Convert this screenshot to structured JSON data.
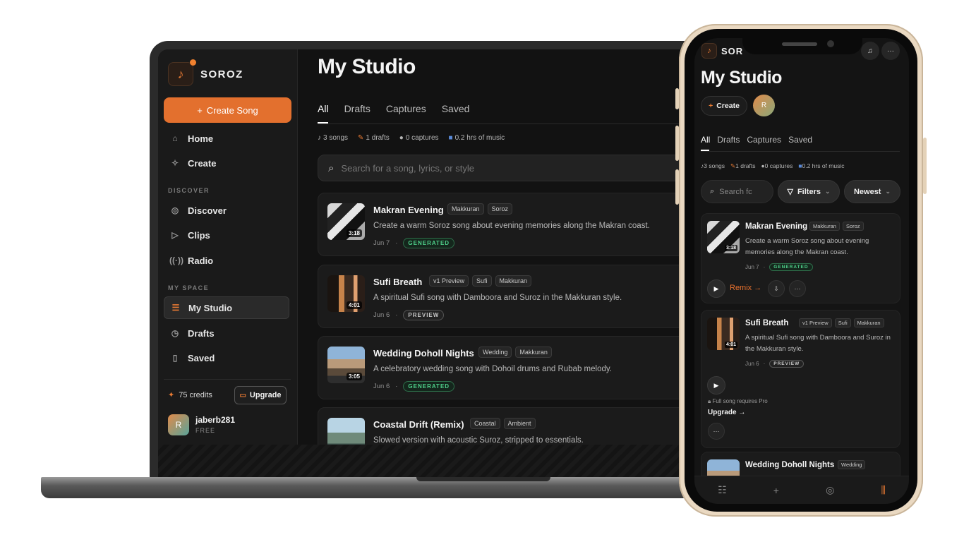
{
  "brand": {
    "name": "SOROZ",
    "short": "SOR"
  },
  "sidebar": {
    "create_label": "Create Song",
    "nav_home": "Home",
    "nav_create": "Create",
    "section_discover": "DISCOVER",
    "nav_discover": "Discover",
    "nav_clips": "Clips",
    "nav_radio": "Radio",
    "section_myspace": "MY SPACE",
    "nav_mystudio": "My Studio",
    "nav_drafts": "Drafts",
    "nav_saved": "Saved",
    "credits": "75 credits",
    "upgrade": "Upgrade",
    "user_name": "jaberb281",
    "user_plan": "FREE",
    "user_initial": "R"
  },
  "main": {
    "title": "My Studio",
    "tabs": [
      "All",
      "Drafts",
      "Captures",
      "Saved"
    ],
    "stats": {
      "songs": "3 songs",
      "drafts": "1 drafts",
      "captures": "0 captures",
      "hours": "0.2 hrs of music"
    },
    "search_placeholder": "Search for a song, lyrics, or style",
    "songs": [
      {
        "title": "Makran Evening",
        "tags": [
          "Makkuran",
          "Soroz"
        ],
        "desc": "Create a warm Soroz song about evening memories along the Makran coast.",
        "date": "Jun 7",
        "status": "GENERATED",
        "duration": "3:18"
      },
      {
        "title": "Sufi Breath",
        "tags": [
          "v1 Preview",
          "Sufi",
          "Makkuran"
        ],
        "desc": "A spiritual Sufi song with Damboora and Suroz in the Makkuran style.",
        "date": "Jun 6",
        "status": "PREVIEW",
        "duration": "4:01"
      },
      {
        "title": "Wedding Doholl Nights",
        "tags": [
          "Wedding",
          "Makkuran"
        ],
        "desc": "A celebratory wedding song with Dohoil drums and Rubab melody.",
        "date": "Jun 6",
        "status": "GENERATED",
        "duration": "3:05"
      },
      {
        "title": "Coastal Drift (Remix)",
        "tags": [
          "Coastal",
          "Ambient"
        ],
        "desc": "Slowed version with acoustic Suroz, stripped to essentials.",
        "date": "",
        "status": "",
        "duration": ""
      }
    ]
  },
  "phone": {
    "title": "My Studio",
    "create_label": "Create",
    "avatar_initial": "R",
    "tabs": [
      "All",
      "Drafts",
      "Captures",
      "Saved"
    ],
    "stats": {
      "songs": "3 songs",
      "drafts": "1 drafts",
      "captures": "0 captures",
      "hours": "0.2 hrs of music"
    },
    "search_text": "Search fc",
    "filters_label": "Filters",
    "sort_label": "Newest",
    "songs": [
      {
        "title": "Makran Evening",
        "tags": [
          "Makkuran",
          "Soroz"
        ],
        "desc": "Create a warm Soroz song about evening memories along the Makran coast.",
        "date": "Jun 7",
        "status": "GENERATED",
        "duration": "3:18",
        "remix": "Remix →"
      },
      {
        "title": "Sufi Breath",
        "tags": [
          "v1 Preview",
          "Sufi",
          "Makkuran"
        ],
        "desc": "A spiritual Sufi song with Damboora and Suroz in the Makkuran style.",
        "date": "Jun 6",
        "status": "PREVIEW",
        "duration": "4:01",
        "lock_note": "Full song requires Pro",
        "upgrade": "Upgrade →"
      },
      {
        "title": "Wedding Doholl Nights",
        "tags": [
          "Wedding"
        ]
      }
    ]
  },
  "colors": {
    "accent": "#e3702e",
    "background": "#121212",
    "generated": "#4fd08a"
  }
}
